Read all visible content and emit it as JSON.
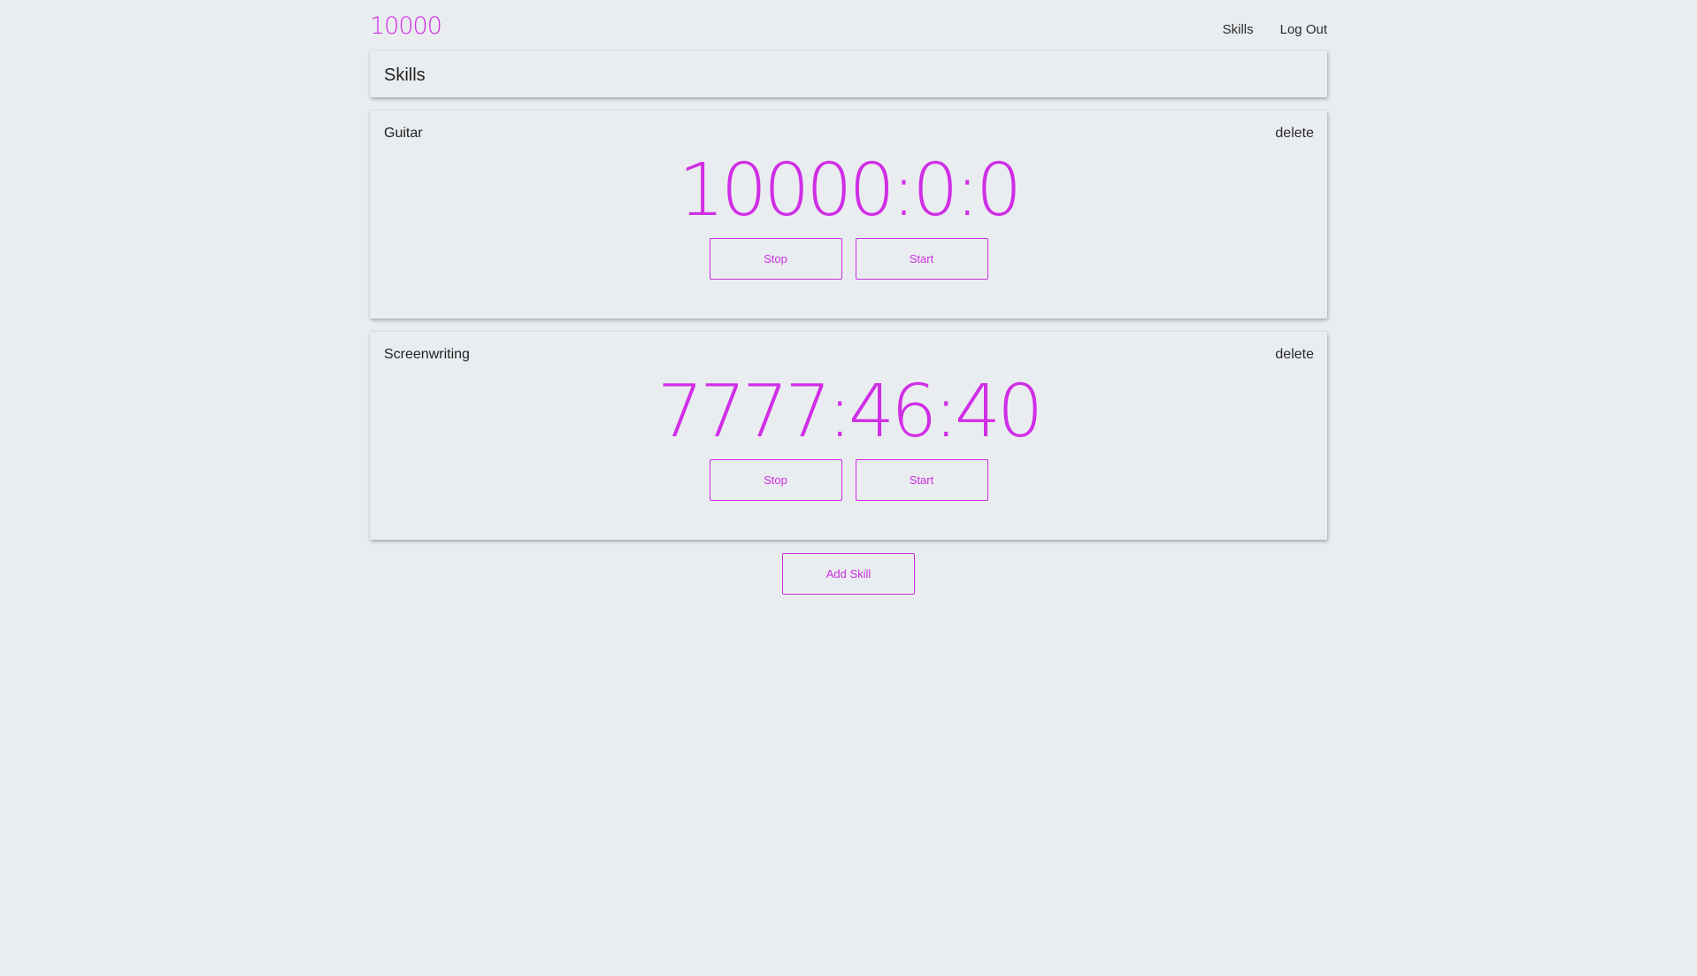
{
  "nav": {
    "brand": "10000",
    "links": [
      {
        "label": "Skills"
      },
      {
        "label": "Log Out"
      }
    ]
  },
  "header": {
    "title": "Skills"
  },
  "skills": [
    {
      "name": "Guitar",
      "delete_label": "delete",
      "time": "10000:0:0",
      "stop_label": "Stop",
      "start_label": "Start"
    },
    {
      "name": "Screenwriting",
      "delete_label": "delete",
      "time": "7777:46:40",
      "stop_label": "Stop",
      "start_label": "Start"
    }
  ],
  "add_skill_label": "Add Skill",
  "colors": {
    "accent": "#d02ee6",
    "background": "#eaedf0"
  }
}
